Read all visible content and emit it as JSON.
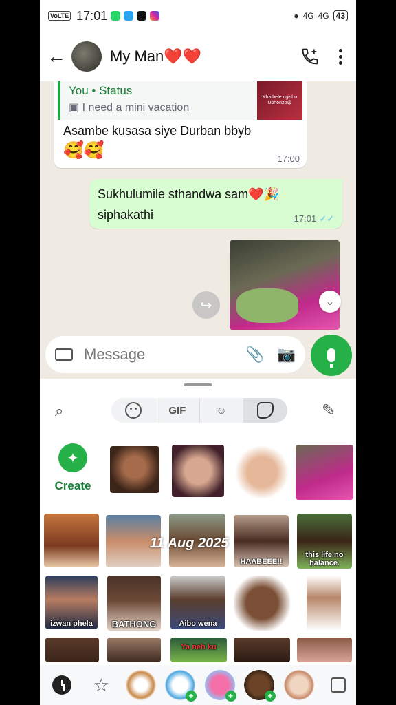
{
  "status_bar": {
    "network_badge": "VoLTE",
    "time": "17:01",
    "signal1": "4G",
    "signal2": "4G",
    "battery": "43"
  },
  "header": {
    "contact_name": "My Man❤️❤️"
  },
  "chat": {
    "incoming": {
      "quote_author": "You  •  Status",
      "quote_text": "I need a mini vacation",
      "quote_thumb_text": "Khathele ngisho Ubhonzo😩",
      "text": "Asambe kusasa siye Durban bbyb",
      "emoji": "🥰🥰",
      "time": "17:00"
    },
    "outgoing": {
      "line1": "Sukhulumile sthandwa sam❤️🎉",
      "line2": "siphakathi",
      "time": "17:01",
      "ticks": "✓✓"
    }
  },
  "composer": {
    "placeholder": "Message"
  },
  "sticker_panel": {
    "tabs": [
      "emoji",
      "GIF",
      "avatar",
      "stickers"
    ],
    "gif_label": "GIF",
    "create_label": "Create",
    "captions": {
      "haaabeee": "HAABEEE!!",
      "balance": "this life no balance.",
      "izwan": "izwan phela",
      "bathong": "BATHONG",
      "aibo": "Aibo wena",
      "yanehk": "Ya neh ku"
    },
    "overlay_date": "11 Aug 2025"
  },
  "colors": {
    "accent_green": "#25b048",
    "outgoing_bubble": "#d9fdd3",
    "chat_bg": "#efeae2"
  }
}
